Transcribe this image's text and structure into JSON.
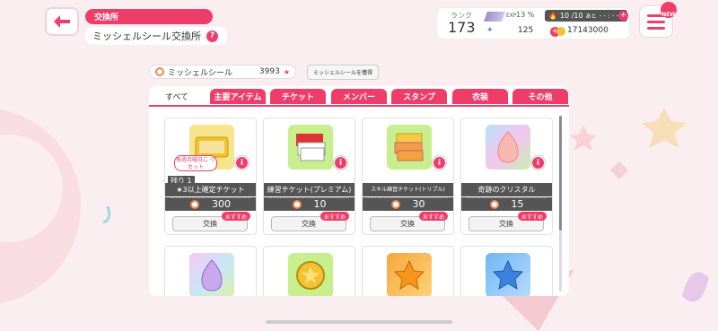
{
  "header": {
    "section_tag": "交換所",
    "title": "ミッシェルシール交換所",
    "help_label": "?"
  },
  "status": {
    "rank_label": "ランク",
    "rank_value": "173",
    "exp_label": "EXP",
    "exp_percent": "13 %",
    "stamina": "10 /10",
    "stamina_suffix": "あと",
    "stamina_timer": "- - : - -",
    "stars": "125",
    "coins": "17143000",
    "new_badge": "NEW"
  },
  "currency": {
    "name": "ミッシェルシール",
    "amount": "3993",
    "howto_label": "ミッシェルシールを獲得"
  },
  "tabs": [
    {
      "label": "すべて",
      "active": true
    },
    {
      "label": "主要アイテム",
      "active": false
    },
    {
      "label": "チケット",
      "active": false
    },
    {
      "label": "メンバー",
      "active": false
    },
    {
      "label": "スタンプ",
      "active": false
    },
    {
      "label": "衣装",
      "active": false
    },
    {
      "label": "その他",
      "active": false
    }
  ],
  "items": [
    {
      "name": "★3以上確定チケット",
      "cost": "300",
      "exchange_label": "交換",
      "recommend": "おすすめ",
      "remaining": "残り 1",
      "reset_note": "毎週月曜日に リセット",
      "icon": "ticket-gold"
    },
    {
      "name": "練習チケット(プレミアム)",
      "cost": "10",
      "exchange_label": "交換",
      "recommend": "おすすめ",
      "icon": "ticket-red"
    },
    {
      "name": "スキル練習チケット(トリプル)",
      "cost": "30",
      "exchange_label": "交換",
      "recommend": "おすすめ",
      "icon": "ticket-orange"
    },
    {
      "name": "奇跡のクリスタル",
      "cost": "15",
      "exchange_label": "交換",
      "recommend": "おすすめ",
      "icon": "crystal-pink"
    }
  ],
  "items_row2": [
    {
      "icon": "crystal-purple"
    },
    {
      "icon": "coin-star"
    },
    {
      "icon": "star-orange"
    },
    {
      "icon": "star-blue"
    }
  ],
  "colors": {
    "accent": "#ef3d6a",
    "dark_bar": "#555555",
    "background": "#fbeef0"
  }
}
